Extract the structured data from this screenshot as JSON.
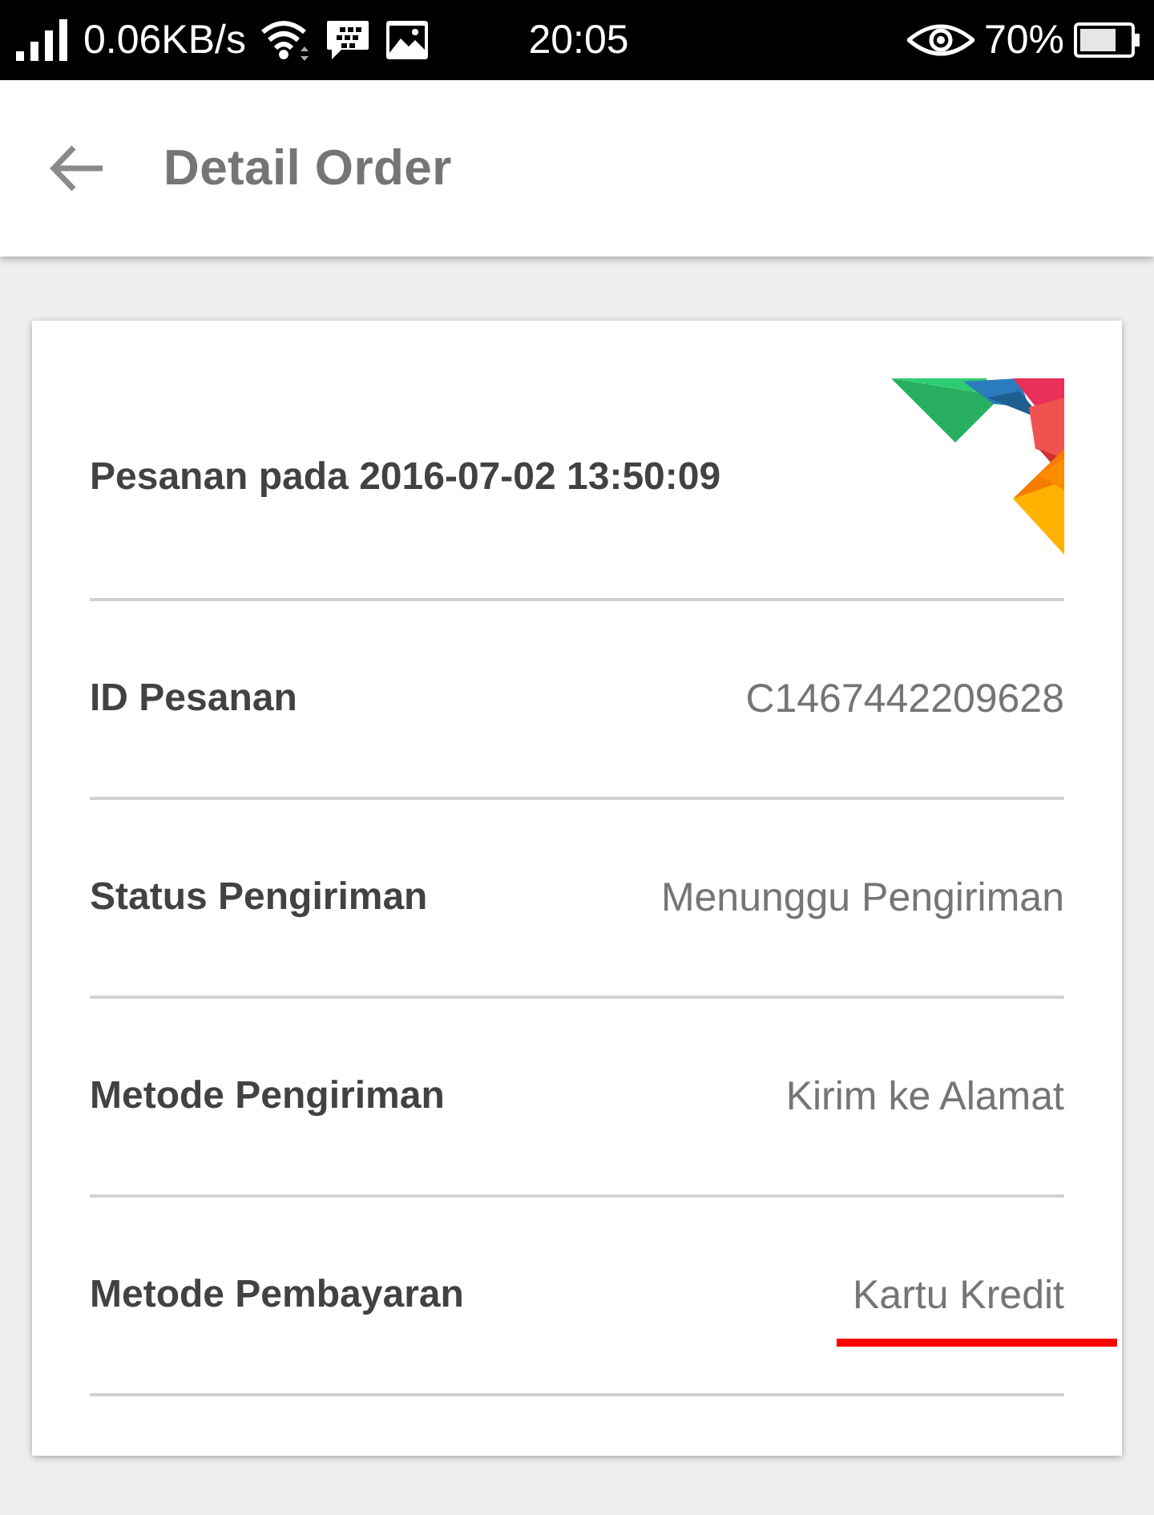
{
  "status_bar": {
    "network_speed": "0.06KB/s",
    "time": "20:05",
    "battery": "70%"
  },
  "app_bar": {
    "title": "Detail Order"
  },
  "order": {
    "header": "Pesanan pada 2016-07-02 13:50:09",
    "rows": [
      {
        "label": "ID Pesanan",
        "value": "C1467442209628",
        "highlighted": false
      },
      {
        "label": "Status Pengiriman",
        "value": "Menunggu Pengiriman",
        "highlighted": false
      },
      {
        "label": "Metode Pengiriman",
        "value": "Kirim ke Alamat",
        "highlighted": false
      },
      {
        "label": "Metode Pembayaran",
        "value": "Kartu Kredit",
        "highlighted": true
      }
    ]
  }
}
